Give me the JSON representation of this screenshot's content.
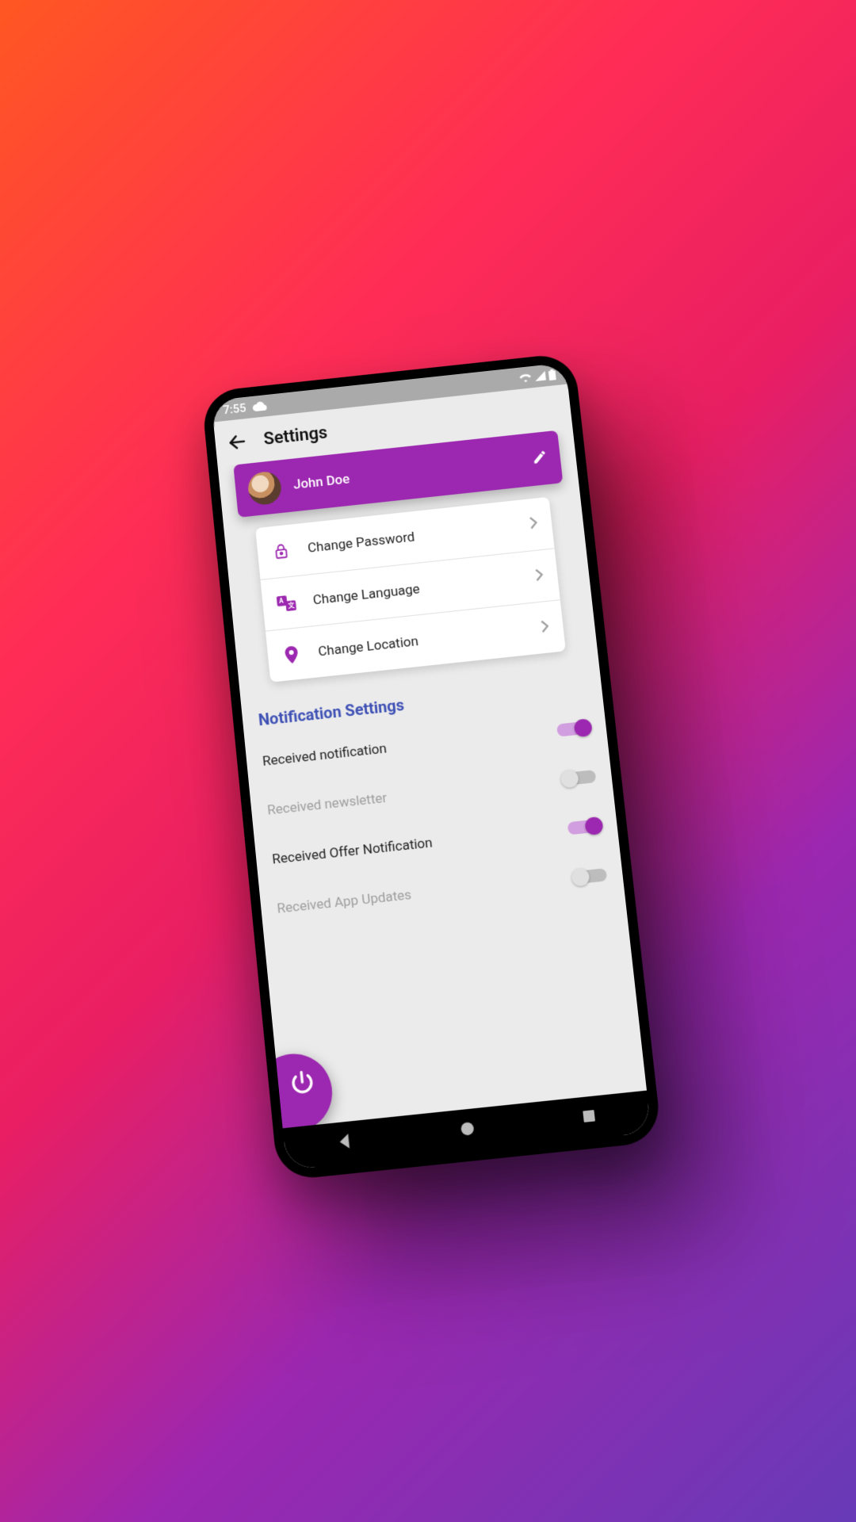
{
  "status": {
    "time": "7:55"
  },
  "appBar": {
    "title": "Settings"
  },
  "profile": {
    "name": "John Doe"
  },
  "actions": [
    {
      "icon": "lock",
      "label": "Change Password"
    },
    {
      "icon": "translate",
      "label": "Change Language"
    },
    {
      "icon": "location",
      "label": "Change Location"
    }
  ],
  "notificationSection": {
    "title": "Notification Settings"
  },
  "toggles": [
    {
      "label": "Received notification",
      "on": true
    },
    {
      "label": "Received newsletter",
      "on": false
    },
    {
      "label": "Received Offer Notification",
      "on": true
    },
    {
      "label": "Received App Updates",
      "on": false
    }
  ],
  "colors": {
    "accent": "#9c27b0",
    "sectionTitle": "#3f51b5"
  }
}
